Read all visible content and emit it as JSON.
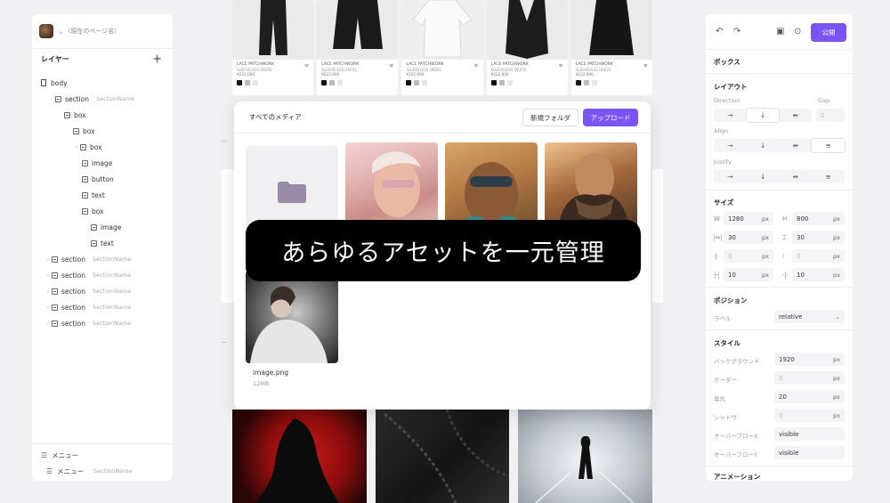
{
  "left_panel": {
    "page_name": "(現在のページ名)",
    "layers_title": "レイヤー",
    "tree": [
      {
        "label": "body",
        "sub": ""
      },
      {
        "label": "section",
        "sub": "SectionName"
      },
      {
        "label": "box",
        "sub": ""
      },
      {
        "label": "box",
        "sub": ""
      },
      {
        "label": "box",
        "sub": ""
      },
      {
        "label": "image",
        "sub": ""
      },
      {
        "label": "button",
        "sub": ""
      },
      {
        "label": "text",
        "sub": ""
      },
      {
        "label": "box",
        "sub": ""
      },
      {
        "label": "image",
        "sub": ""
      },
      {
        "label": "text",
        "sub": ""
      },
      {
        "label": "section",
        "sub": "SectionName"
      },
      {
        "label": "section",
        "sub": "SectionName"
      },
      {
        "label": "section",
        "sub": "SectionName"
      },
      {
        "label": "section",
        "sub": "SectionName"
      },
      {
        "label": "section",
        "sub": "SectionName"
      }
    ],
    "menu_title": "メニュー",
    "menu_item": {
      "label": "メニュー",
      "sub": "SectionName"
    }
  },
  "products": [
    {
      "name": "LACE PATCHWORK",
      "sub": "SLEEVELESS DRESS",
      "price": "¥222,000"
    },
    {
      "name": "LACE PATCHWORK",
      "sub": "SLEEVELESS DRESS",
      "price": "¥222,000"
    },
    {
      "name": "LACE PATCHWORK",
      "sub": "SLEEVELESS DRESS",
      "price": "¥222,000"
    },
    {
      "name": "LACE PATCHWORK",
      "sub": "SLEEVELESS DRESS",
      "price": "¥222,000"
    },
    {
      "name": "LACE PATCHWORK",
      "sub": "SLEEVELESS DRESS",
      "price": "¥222,000"
    }
  ],
  "media_modal": {
    "title": "すべてのメディア",
    "new_folder": "新規フォルダ",
    "upload": "アップロード",
    "file_name": "image.png",
    "file_size": "12MB"
  },
  "toast": "あらゆるアセットを一元管理",
  "right_panel": {
    "publish": "公開",
    "box_title": "ボックス",
    "layout_title": "レイアウト",
    "direction": "Direction",
    "gap": "Gap",
    "gap_value": "0",
    "align": "Align",
    "justify": "Justify",
    "size_title": "サイズ",
    "w_label": "W",
    "w_value": "1280",
    "h_label": "H",
    "h_value": "800",
    "unit": "px",
    "padding_x": "30",
    "padding_y": "30",
    "margin_x": "0",
    "margin_y": "0",
    "min_a": "10",
    "min_b": "10",
    "position_title": "ポジション",
    "label_label": "ラベル",
    "position_value": "relative",
    "style_title": "スタイル",
    "background_label": "バックグラウンド",
    "background_value": "1920",
    "border_label": "ボーダー",
    "border_value": "0",
    "radius_label": "角丸",
    "radius_value": "20",
    "shadow_label": "シャドウ",
    "shadow_value": "0",
    "overflow_x_label": "オーバーフローX",
    "overflow_x_value": "visible",
    "overflow_y_label": "オーバーフローY",
    "overflow_y_value": "visible",
    "animation_title": "アニメーション"
  },
  "colors": {
    "accent": "#7a55f3",
    "toast_bg": "#000000",
    "panel_bg": "#ffffff",
    "page_bg": "#f1f1f3"
  }
}
